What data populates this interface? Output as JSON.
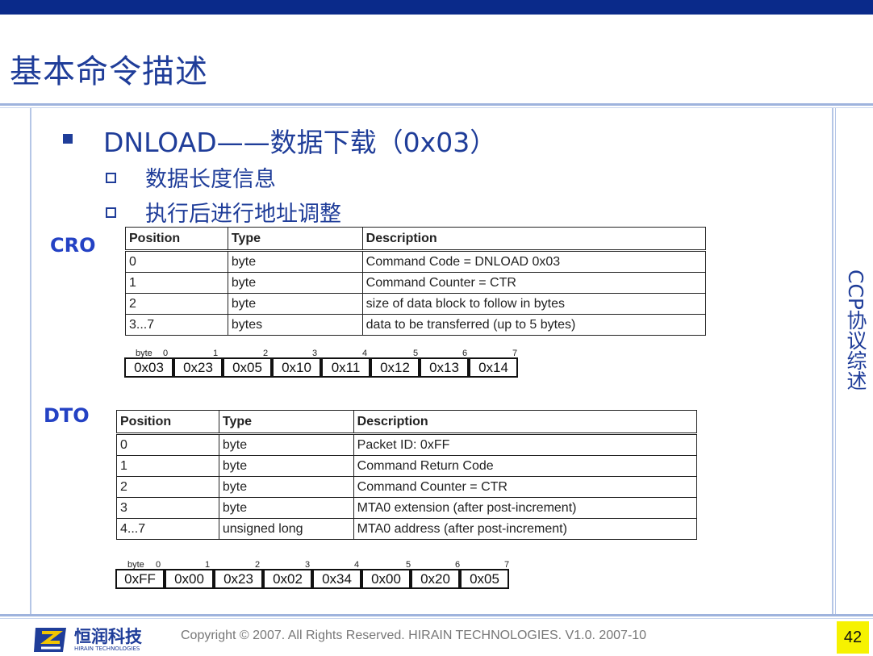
{
  "slide": {
    "title": "基本命令描述",
    "side_label": "CCP协议综述",
    "page_number": "42",
    "copyright": "Copyright © 2007. All Rights Reserved. HIRAIN TECHNOLOGIES. V1.0. 2007-10"
  },
  "logo": {
    "cn_name": "恒润科技",
    "en_name": "HIRAIN TECHNOLOGIES"
  },
  "bullets": {
    "main": "DNLOAD——数据下载（0x03）",
    "sub": [
      "数据长度信息",
      "执行后进行地址调整"
    ]
  },
  "cro": {
    "label": "CRO",
    "headers": [
      "Position",
      "Type",
      "Description"
    ],
    "rows": [
      [
        "0",
        "byte",
        "Command Code = DNLOAD 0x03"
      ],
      [
        "1",
        "byte",
        "Command Counter = CTR"
      ],
      [
        "2",
        "byte",
        "size of data block to follow in bytes"
      ],
      [
        "3...7",
        "bytes",
        "data to be transferred (up to 5 bytes)"
      ]
    ],
    "byte_label": "byte",
    "byte_indices": [
      "0",
      "1",
      "2",
      "3",
      "4",
      "5",
      "6",
      "7"
    ],
    "bytes": [
      "0x03",
      "0x23",
      "0x05",
      "0x10",
      "0x11",
      "0x12",
      "0x13",
      "0x14"
    ]
  },
  "dto": {
    "label": "DTO",
    "headers": [
      "Position",
      "Type",
      "Description"
    ],
    "rows": [
      [
        "0",
        "byte",
        "Packet ID: 0xFF"
      ],
      [
        "1",
        "byte",
        "Command Return Code"
      ],
      [
        "2",
        "byte",
        "Command Counter = CTR"
      ],
      [
        "3",
        "byte",
        "MTA0 extension (after post-increment)"
      ],
      [
        "4...7",
        "unsigned long",
        "MTA0 address (after post-increment)"
      ]
    ],
    "byte_label": "byte",
    "byte_indices": [
      "0",
      "1",
      "2",
      "3",
      "4",
      "5",
      "6",
      "7"
    ],
    "bytes": [
      "0xFF",
      "0x00",
      "0x23",
      "0x02",
      "0x34",
      "0x00",
      "0x20",
      "0x05"
    ]
  },
  "colors": {
    "primary": "#1f3d99",
    "top_bar": "#0a2a8a",
    "page_number_bg": "#f6f200"
  }
}
